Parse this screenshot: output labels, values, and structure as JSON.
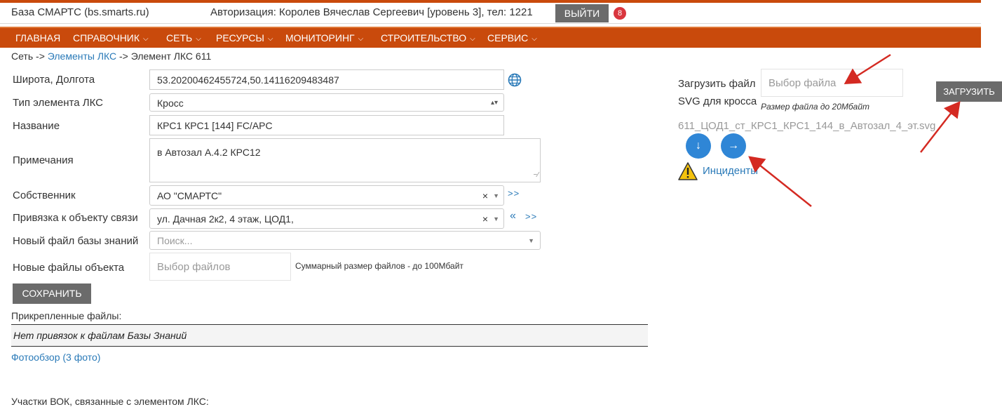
{
  "header": {
    "site_title": "База СМАРТС (bs.smarts.ru)",
    "auth_text": "Авторизация: Королев Вячеслав Сергеевич [уровень 3], тел: 1221",
    "logout_label": "ВЫЙТИ",
    "notification_count": "8"
  },
  "menu": [
    {
      "label": "ГЛАВНАЯ"
    },
    {
      "label": "СПРАВОЧНИК"
    },
    {
      "label": "СЕТЬ"
    },
    {
      "label": "РЕСУРСЫ"
    },
    {
      "label": "МОНИТОРИНГ"
    },
    {
      "label": "СТРОИТЕЛЬСТВО"
    },
    {
      "label": "СЕРВИС"
    }
  ],
  "breadcrumb": {
    "root": "Сеть",
    "sep": "->",
    "link": "Элементы ЛКС",
    "current": "Элемент ЛКС 611"
  },
  "form": {
    "coords_label": "Широта, Долгота",
    "coords_value": "53.20200462455724,50.14116209483487",
    "type_label": "Тип элемента ЛКС",
    "type_value": "Кросс",
    "name_label": "Название",
    "name_value": "КРС1 КРС1 [144] FC/APC",
    "notes_label": "Примечания",
    "notes_value": "в Автозал А.4.2 КРС12",
    "owner_label": "Собственник",
    "owner_value": "АО \"СМАРТС\"",
    "owner_nav": ">>",
    "binding_label": "Привязка к объекту связи",
    "binding_value": "ул. Дачная 2к2, 4 этаж, ЦОД1,",
    "binding_nav_prev": "«",
    "binding_nav_next": ">>",
    "kb_label": "Новый файл базы знаний",
    "kb_placeholder": "Поиск...",
    "files_label": "Новые файлы объекта",
    "files_placeholder": "Выбор файлов",
    "files_hint": "Суммарный размер файлов - до 100Мбайт",
    "save_label": "СОХРАНИТЬ",
    "clear_symbol": "×"
  },
  "attachments": {
    "title": "Прикрепленные файлы:",
    "empty_text": "Нет привязок к файлам Базы Знаний",
    "photo_link": "Фотообзор (3 фото)",
    "vok_title": "Участки ВОК, связанные с элементом ЛКС:"
  },
  "right_panel": {
    "upload_label_1": "Загрузить файл",
    "upload_label_2": "SVG для кросса",
    "file_placeholder": "Выбор файла",
    "size_hint": "Размер файла до 20Мбайт",
    "upload_button": "ЗАГРУЗИТЬ",
    "svg_filename": "611_ЦОД1_ст_КРС1_КРС1_144_в_Автозал_4_эт.svg",
    "download_symbol": "↓",
    "open_symbol": "→",
    "incidents_link": "Инциденты"
  },
  "colors": {
    "brand_orange": "#c94a0c",
    "button_gray": "#6b6b6b",
    "link_blue": "#2a7ab8",
    "circle_blue": "#2f86d6",
    "annotation_red": "#d42a22"
  },
  "icons": [
    "globe-icon",
    "chevron-down-icon",
    "warning-icon",
    "download-icon",
    "arrow-right-icon"
  ]
}
